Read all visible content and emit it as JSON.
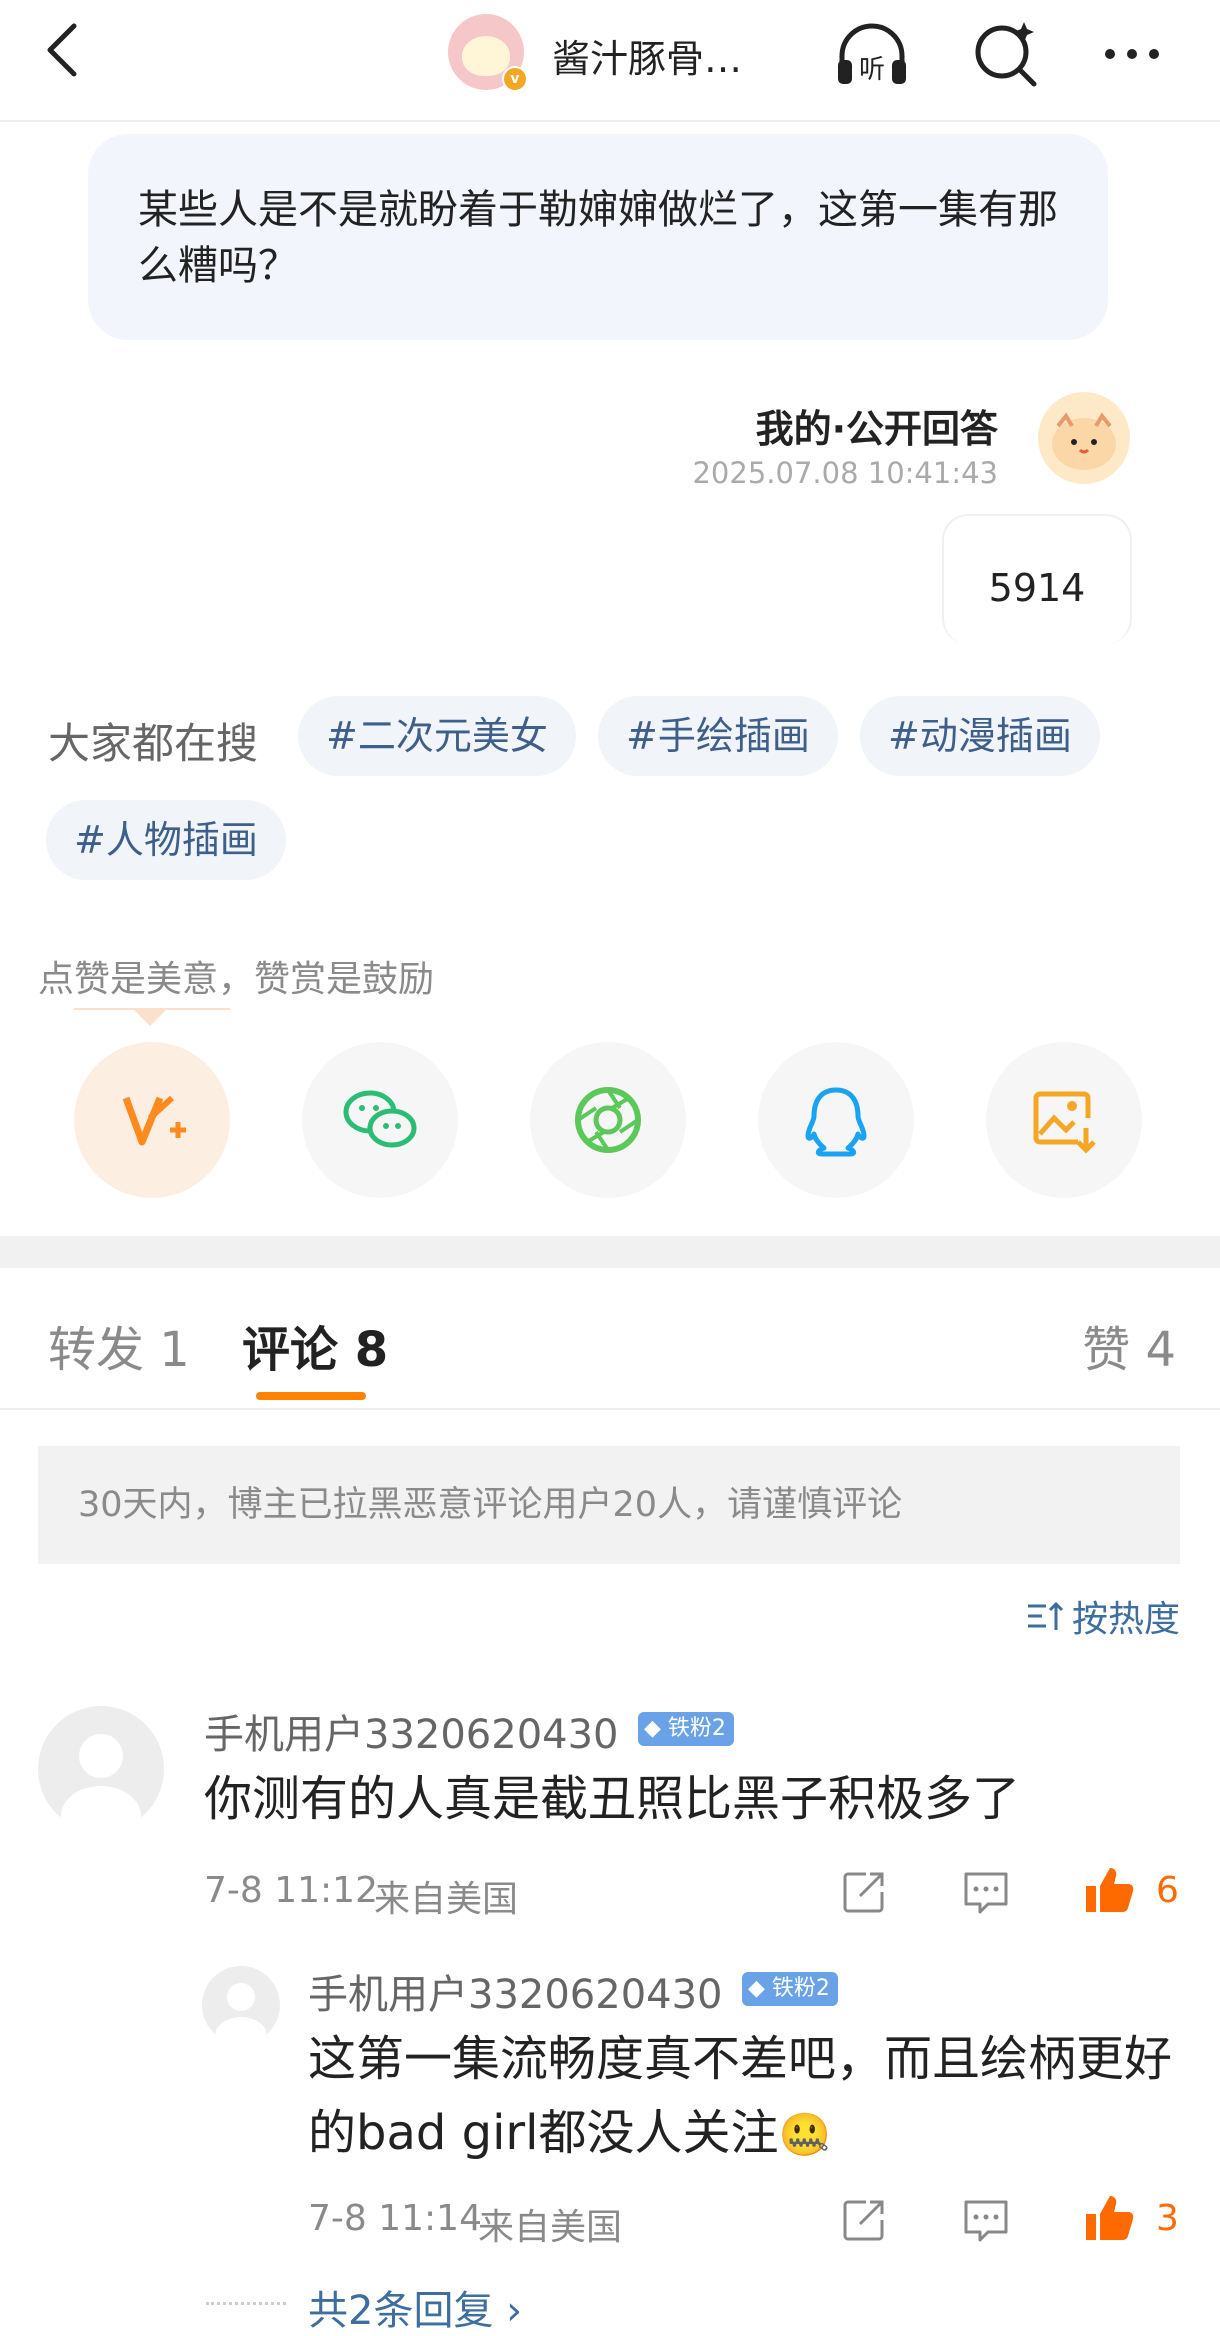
{
  "header": {
    "title": "酱汁豚骨…",
    "avatar_badge": "v"
  },
  "question": {
    "text": "某些人是不是就盼着于勒婶婶做烂了，这第一集有那么糟吗？"
  },
  "answer": {
    "title": "我的·公开回答",
    "time": "2025.07.08 10:41:43",
    "content": "5914"
  },
  "search": {
    "label": "大家都在搜",
    "tags": [
      "#二次元美女",
      "#手绘插画",
      "#动漫插画",
      "#人物插画"
    ]
  },
  "tip": "点赞是美意，赞赏是鼓励",
  "share_icons": [
    "v-plus-icon",
    "wechat-icon",
    "moments-icon",
    "qq-icon",
    "save-image-icon"
  ],
  "tabs": {
    "repost": "转发 1",
    "comments": "评论 8",
    "likes": "赞 4"
  },
  "notice": "30天内，博主已拉黑恶意评论用户20人，请谨慎评论",
  "sort_label": "按热度",
  "comments": [
    {
      "user": "手机用户3320620430",
      "badge": "铁粉2",
      "text": "你测有的人真是截丑照比黑子积极多了",
      "time": "7-8 11:12",
      "location": "来自美国",
      "likes": "6"
    }
  ],
  "replies": [
    {
      "user": "手机用户3320620430",
      "badge": "铁粉2",
      "text_line1": "这第一集流畅度真不差吧，而且绘柄更好",
      "text_line2": "的bad girl都没人关注",
      "emoji": "🤐",
      "time": "7-8 11:14",
      "location": "来自美国",
      "likes": "3"
    }
  ],
  "more_replies": "共2条回复 ›",
  "colors": {
    "accent": "#ff8200",
    "link": "#3e6e9e",
    "like": "#ff6a00",
    "badge": "#6aa2e8"
  }
}
